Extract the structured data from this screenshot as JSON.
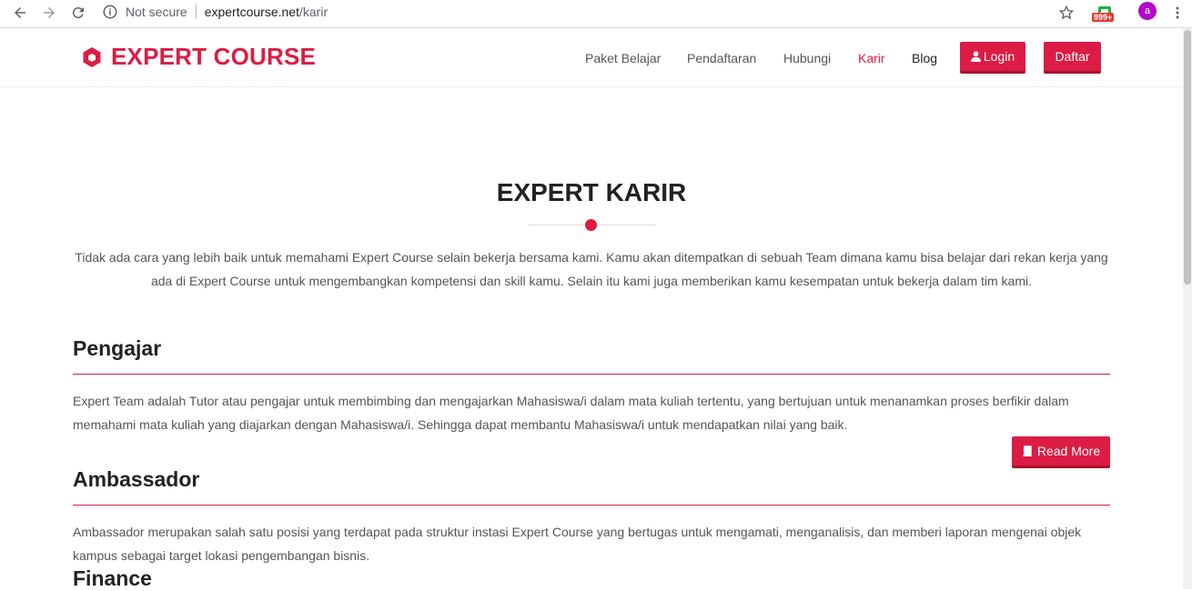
{
  "browser": {
    "security_label": "Not secure",
    "url_host": "expertcourse.net",
    "url_path": "/karir",
    "extension_badge": "999+",
    "profile_initial": "a"
  },
  "header": {
    "logo_text": "EXPERT COURSE",
    "nav": {
      "paket": "Paket Belajar",
      "pendaftaran": "Pendaftaran",
      "hubungi": "Hubungi",
      "karir": "Karir",
      "blog": "Blog"
    },
    "login_label": "Login",
    "daftar_label": "Daftar"
  },
  "main": {
    "title": "EXPERT KARIR",
    "intro": "Tidak ada cara yang lebih baik untuk memahami Expert Course selain bekerja bersama kami. Kamu akan ditempatkan di sebuah Team dimana kamu bisa belajar dari rekan kerja yang ada di Expert Course untuk mengembangkan kompetensi dan skill kamu. Selain itu kami juga memberikan kamu kesempatan untuk bekerja dalam tim kami.",
    "sections": [
      {
        "title": "Pengajar",
        "text": "Expert Team adalah Tutor atau pengajar untuk membimbing dan mengajarkan Mahasiswa/i dalam mata kuliah tertentu, yang bertujuan untuk menanamkan proses berfikir dalam memahami mata kuliah yang diajarkan dengan Mahasiswa/i. Sehingga dapat membantu Mahasiswa/i untuk mendapatkan nilai yang baik.",
        "button": "Read More"
      },
      {
        "title": "Ambassador",
        "text": "Ambassador merupakan salah satu posisi yang terdapat pada struktur instasi Expert Course yang bertugas untuk mengamati, menganalisis, dan memberi laporan mengenai objek kampus sebagai target lokasi pengembangan bisnis."
      },
      {
        "title": "Finance"
      }
    ]
  },
  "colors": {
    "brand": "#dc1c44",
    "text": "#555555",
    "heading": "#222222"
  }
}
